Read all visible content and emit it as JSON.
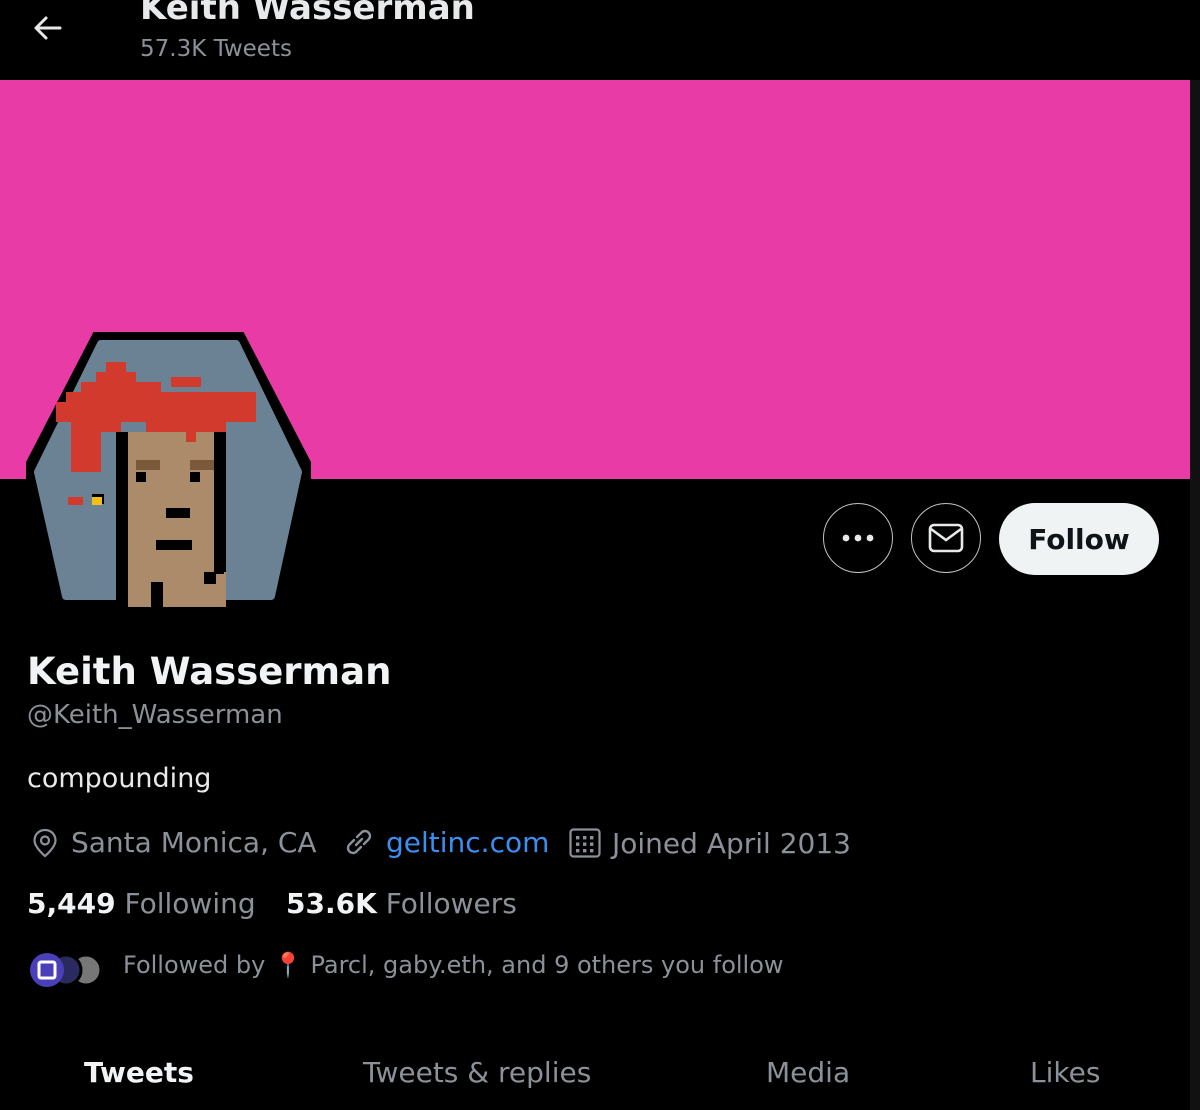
{
  "header": {
    "name": "Keith Wasserman",
    "tweet_count": "57.3K Tweets",
    "back_icon": "arrow-left-icon"
  },
  "banner": {
    "color": "#e83ba6"
  },
  "actions": {
    "more_icon": "ellipsis-icon",
    "message_icon": "envelope-icon",
    "follow_label": "Follow"
  },
  "profile": {
    "name": "Keith Wasserman",
    "handle": "@Keith_Wasserman",
    "bio": "compounding",
    "location": "Santa Monica, CA",
    "website": "geltinc.com",
    "joined": "Joined April 2013",
    "link_color": "#3c8ff0"
  },
  "stats": {
    "following_count": "5,449",
    "following_label": "Following",
    "followers_count": "53.6K",
    "followers_label": "Followers"
  },
  "followed_by": {
    "text": "Followed by 📍 Parcl, gaby.eth, and 9 others you follow"
  },
  "tabs": [
    {
      "label": "Tweets",
      "active": true
    },
    {
      "label": "Tweets & replies",
      "active": false
    },
    {
      "label": "Media",
      "active": false
    },
    {
      "label": "Likes",
      "active": false
    }
  ]
}
